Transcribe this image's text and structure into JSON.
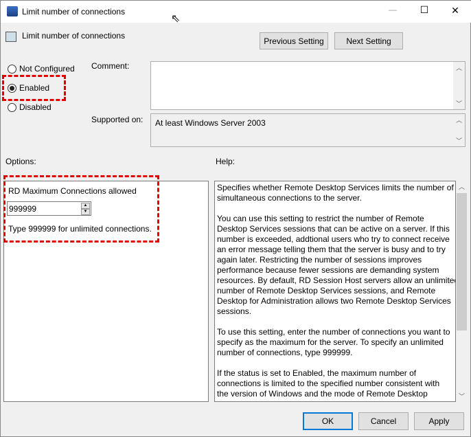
{
  "window": {
    "title": "Limit number of connections",
    "minimize": "—",
    "maximize": "☐",
    "close": "✕"
  },
  "header": {
    "policy_title": "Limit number of connections",
    "previous_label": "Previous Setting",
    "next_label": "Next Setting"
  },
  "state": {
    "options": [
      {
        "label": "Not Configured",
        "checked": false
      },
      {
        "label": "Enabled",
        "checked": true
      },
      {
        "label": "Disabled",
        "checked": false
      }
    ]
  },
  "comment": {
    "label": "Comment:",
    "value": ""
  },
  "supported": {
    "label": "Supported on:",
    "value": "At least Windows Server 2003"
  },
  "options_panel": {
    "label": "Options:",
    "field_label": "RD Maximum Connections allowed",
    "field_value": "999999",
    "hint": "Type 999999 for unlimited connections."
  },
  "help_panel": {
    "label": "Help:",
    "lines": [
      "Specifies whether Remote Desktop Services limits the number of",
      "simultaneous connections to the server.",
      "",
      "You can use this setting to restrict the number of Remote",
      "Desktop Services sessions that can be active on a server. If this",
      "number is exceeded, addtional users who try to connect receive",
      "an error message telling them that the server is busy and to try",
      "again later. Restricting the number of sessions improves",
      "performance because fewer sessions are demanding system",
      "resources. By default, RD Session Host servers allow an unlimited",
      "number of Remote Desktop Services sessions, and Remote",
      "Desktop for Administration allows two Remote Desktop Services",
      "sessions.",
      "",
      "To use this setting, enter the number of connections you want to",
      "specify as the maximum for the server. To specify an unlimited",
      "number of connections, type 999999.",
      "",
      "If the status is set to Enabled, the maximum number of",
      "connections is limited to the specified number consistent with",
      "the version of Windows and the mode of Remote Desktop"
    ]
  },
  "footer": {
    "ok": "OK",
    "cancel": "Cancel",
    "apply": "Apply"
  },
  "colors": {
    "highlight": "#e00000",
    "focus": "#0078d7"
  }
}
